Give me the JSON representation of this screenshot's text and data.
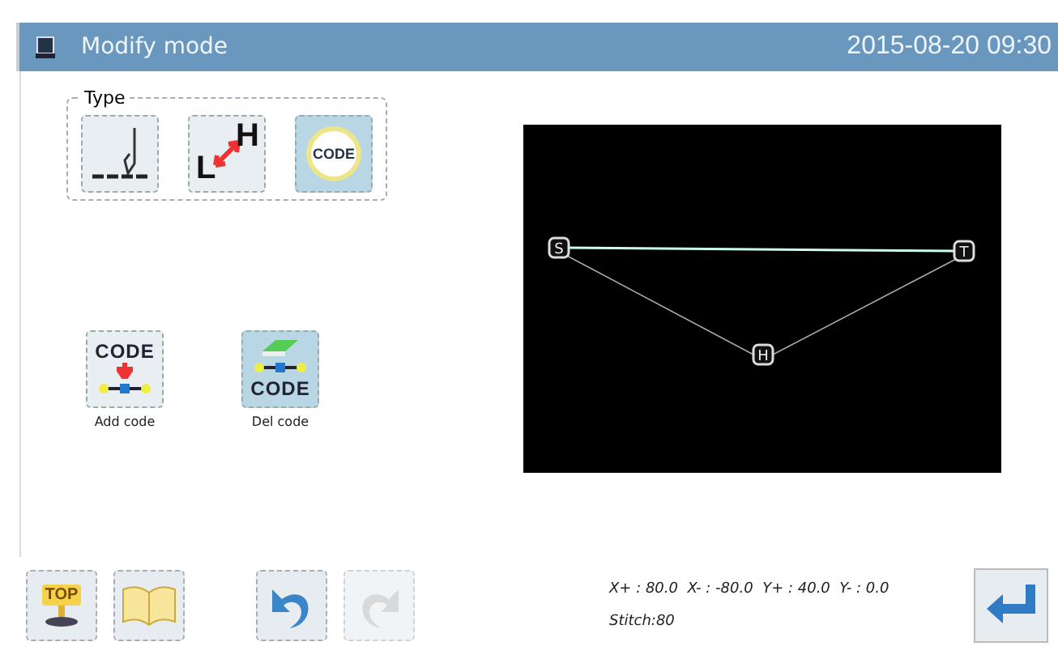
{
  "title_bar": {
    "title": "Modify mode",
    "datetime": "2015-08-20 09:30"
  },
  "type_group": {
    "label": "Type",
    "buttons": [
      {
        "kind": "needle",
        "selected": false
      },
      {
        "kind": "low-high",
        "label_low": "L",
        "label_high": "H",
        "selected": false
      },
      {
        "kind": "code",
        "label": "CODE",
        "selected": true
      }
    ]
  },
  "code_actions": [
    {
      "kind": "add",
      "icon_label": "CODE",
      "caption": "Add code",
      "selected": false
    },
    {
      "kind": "delete",
      "icon_label": "CODE",
      "caption": "Del code",
      "selected": true
    }
  ],
  "canvas": {
    "nodes": [
      {
        "kind": "start",
        "label": "S"
      },
      {
        "kind": "end",
        "label": "T"
      },
      {
        "kind": "hold",
        "label": "H"
      }
    ]
  },
  "toolbar": [
    {
      "kind": "top",
      "label": "TOP",
      "disabled": false
    },
    {
      "kind": "book",
      "disabled": false
    },
    {
      "kind": "undo",
      "disabled": false
    },
    {
      "kind": "redo",
      "disabled": true
    }
  ],
  "readout": {
    "limits": "X+ : 80.0  X- : -80.0  Y+ : 40.0  Y- : 0.0",
    "stitch": "Stitch:80"
  },
  "enter_button": {
    "kind": "enter"
  }
}
